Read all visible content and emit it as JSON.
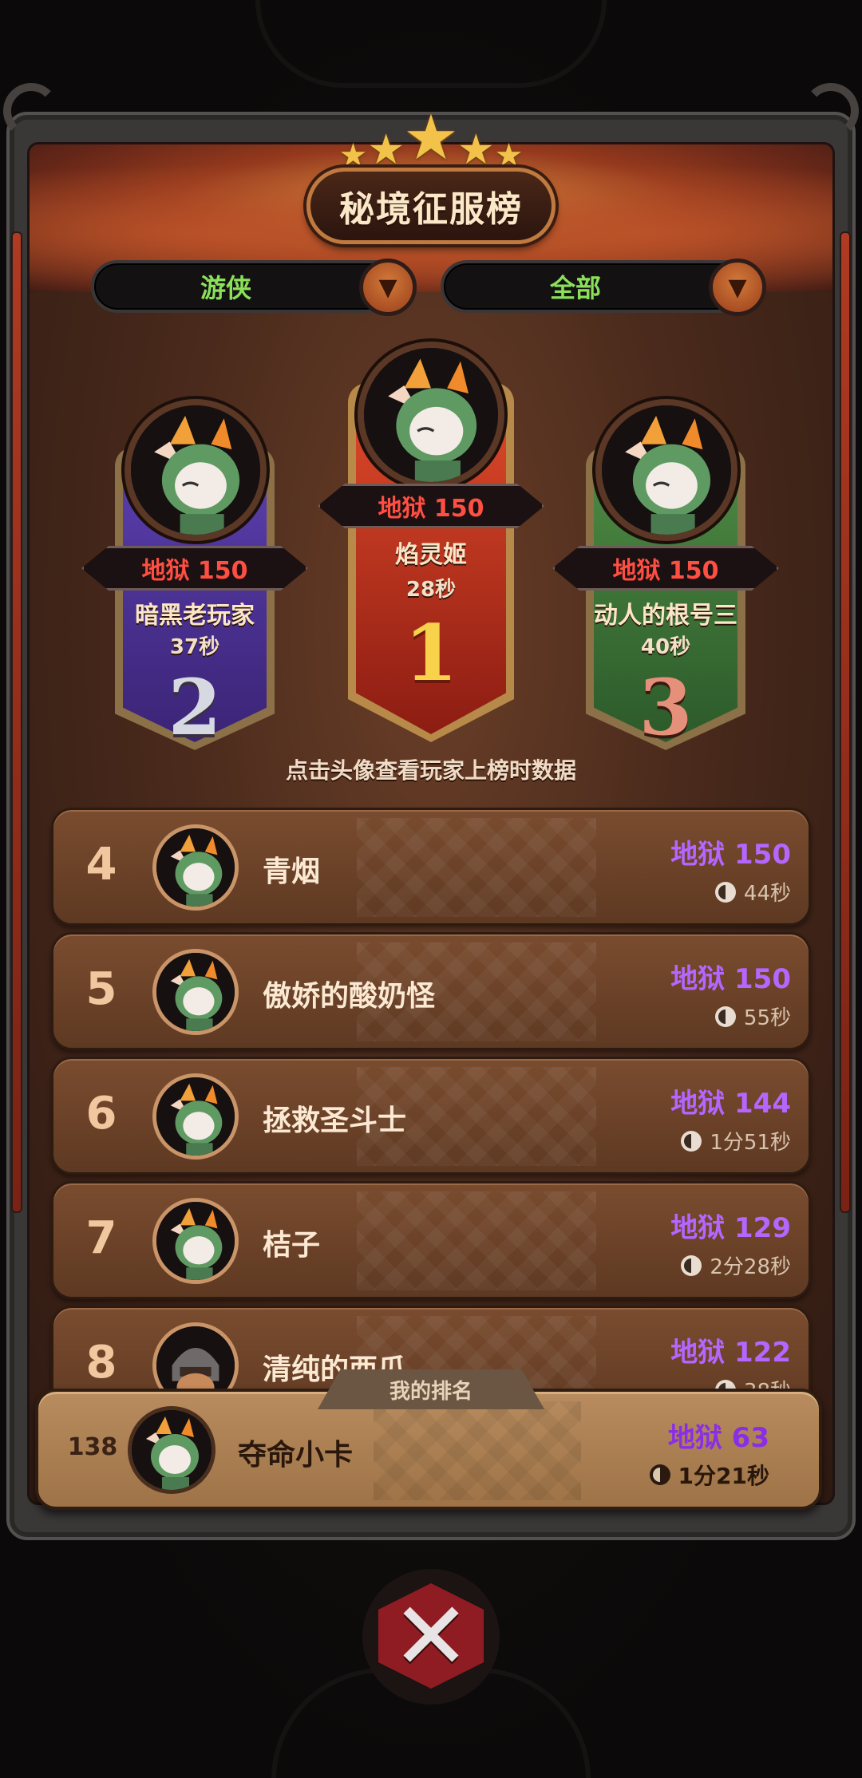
{
  "title": "秘境征服榜",
  "filters": {
    "class_select": "游侠",
    "scope_select": "全部"
  },
  "podium": [
    {
      "rank": "1",
      "score": "地狱 150",
      "name": "焰灵姬",
      "time": "28秒",
      "rank_color": "#f7d24a"
    },
    {
      "rank": "2",
      "score": "地狱 150",
      "name": "暗黑老玩家",
      "time": "37秒",
      "rank_color": "#d6d8e2"
    },
    {
      "rank": "3",
      "score": "地狱 150",
      "name": "动人的根号三",
      "time": "40秒",
      "rank_color": "#e4907a"
    }
  ],
  "hint": "点击头像查看玩家上榜时数据",
  "rows": [
    {
      "rank": "4",
      "name": "青烟",
      "score": "地狱 150",
      "time": "44秒"
    },
    {
      "rank": "5",
      "name": "傲娇的酸奶怪",
      "score": "地狱 150",
      "time": "55秒"
    },
    {
      "rank": "6",
      "name": "拯救圣斗士",
      "score": "地狱 144",
      "time": "1分51秒"
    },
    {
      "rank": "7",
      "name": "桔子",
      "score": "地狱 129",
      "time": "2分28秒"
    },
    {
      "rank": "8",
      "name": "清纯的西瓜",
      "score": "地狱 122",
      "time": "38秒"
    }
  ],
  "my_rank": {
    "tab_label": "我的排名",
    "rank": "138",
    "name": "夺命小卡",
    "score": "地狱 63",
    "time": "1分21秒"
  },
  "colors": {
    "score_red": "#ff4e42",
    "score_purple": "#b566ff",
    "filter_green": "#8be05a"
  },
  "icons": {
    "dropdown": "chevron-down-icon",
    "clock": "clock-icon",
    "close": "close-icon",
    "avatar": "fox-avatar"
  }
}
